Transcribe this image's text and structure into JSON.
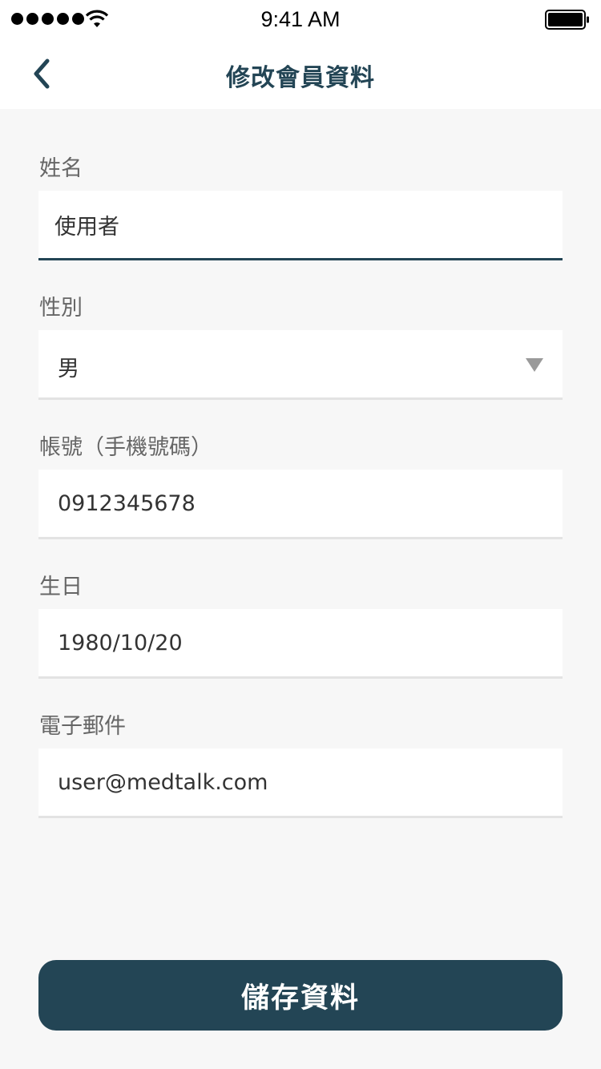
{
  "status_bar": {
    "time": "9:41 AM",
    "signal_icon": "signal-dots-icon",
    "wifi_icon": "wifi-icon",
    "battery_icon": "battery-icon"
  },
  "nav": {
    "title": "修改會員資料",
    "back_icon": "chevron-left-icon"
  },
  "colors": {
    "primary": "#234555",
    "background": "#f7f7f7",
    "label": "#666666",
    "divider": "#e3e3e3"
  },
  "form": {
    "name": {
      "label": "姓名",
      "value": "使用者"
    },
    "gender": {
      "label": "性別",
      "value": "男",
      "icon": "triangle-down-icon"
    },
    "account": {
      "label": "帳號（手機號碼）",
      "value": "0912345678"
    },
    "birthday": {
      "label": "生日",
      "value": "1980/10/20"
    },
    "email": {
      "label": "電子郵件",
      "value": "user@medtalk.com"
    }
  },
  "save_button": {
    "label": "儲存資料"
  }
}
